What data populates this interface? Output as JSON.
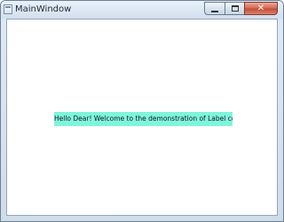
{
  "window": {
    "title": "MainWindow",
    "close_glyph": "✕"
  },
  "content": {
    "label_text": "Hello Dear! Welcome to the demonstration of Label control",
    "label_background": "#7ff5dc"
  },
  "icons": {
    "app": "window-icon",
    "minimize": "minimize-icon",
    "maximize": "maximize-icon",
    "close": "close-icon"
  }
}
